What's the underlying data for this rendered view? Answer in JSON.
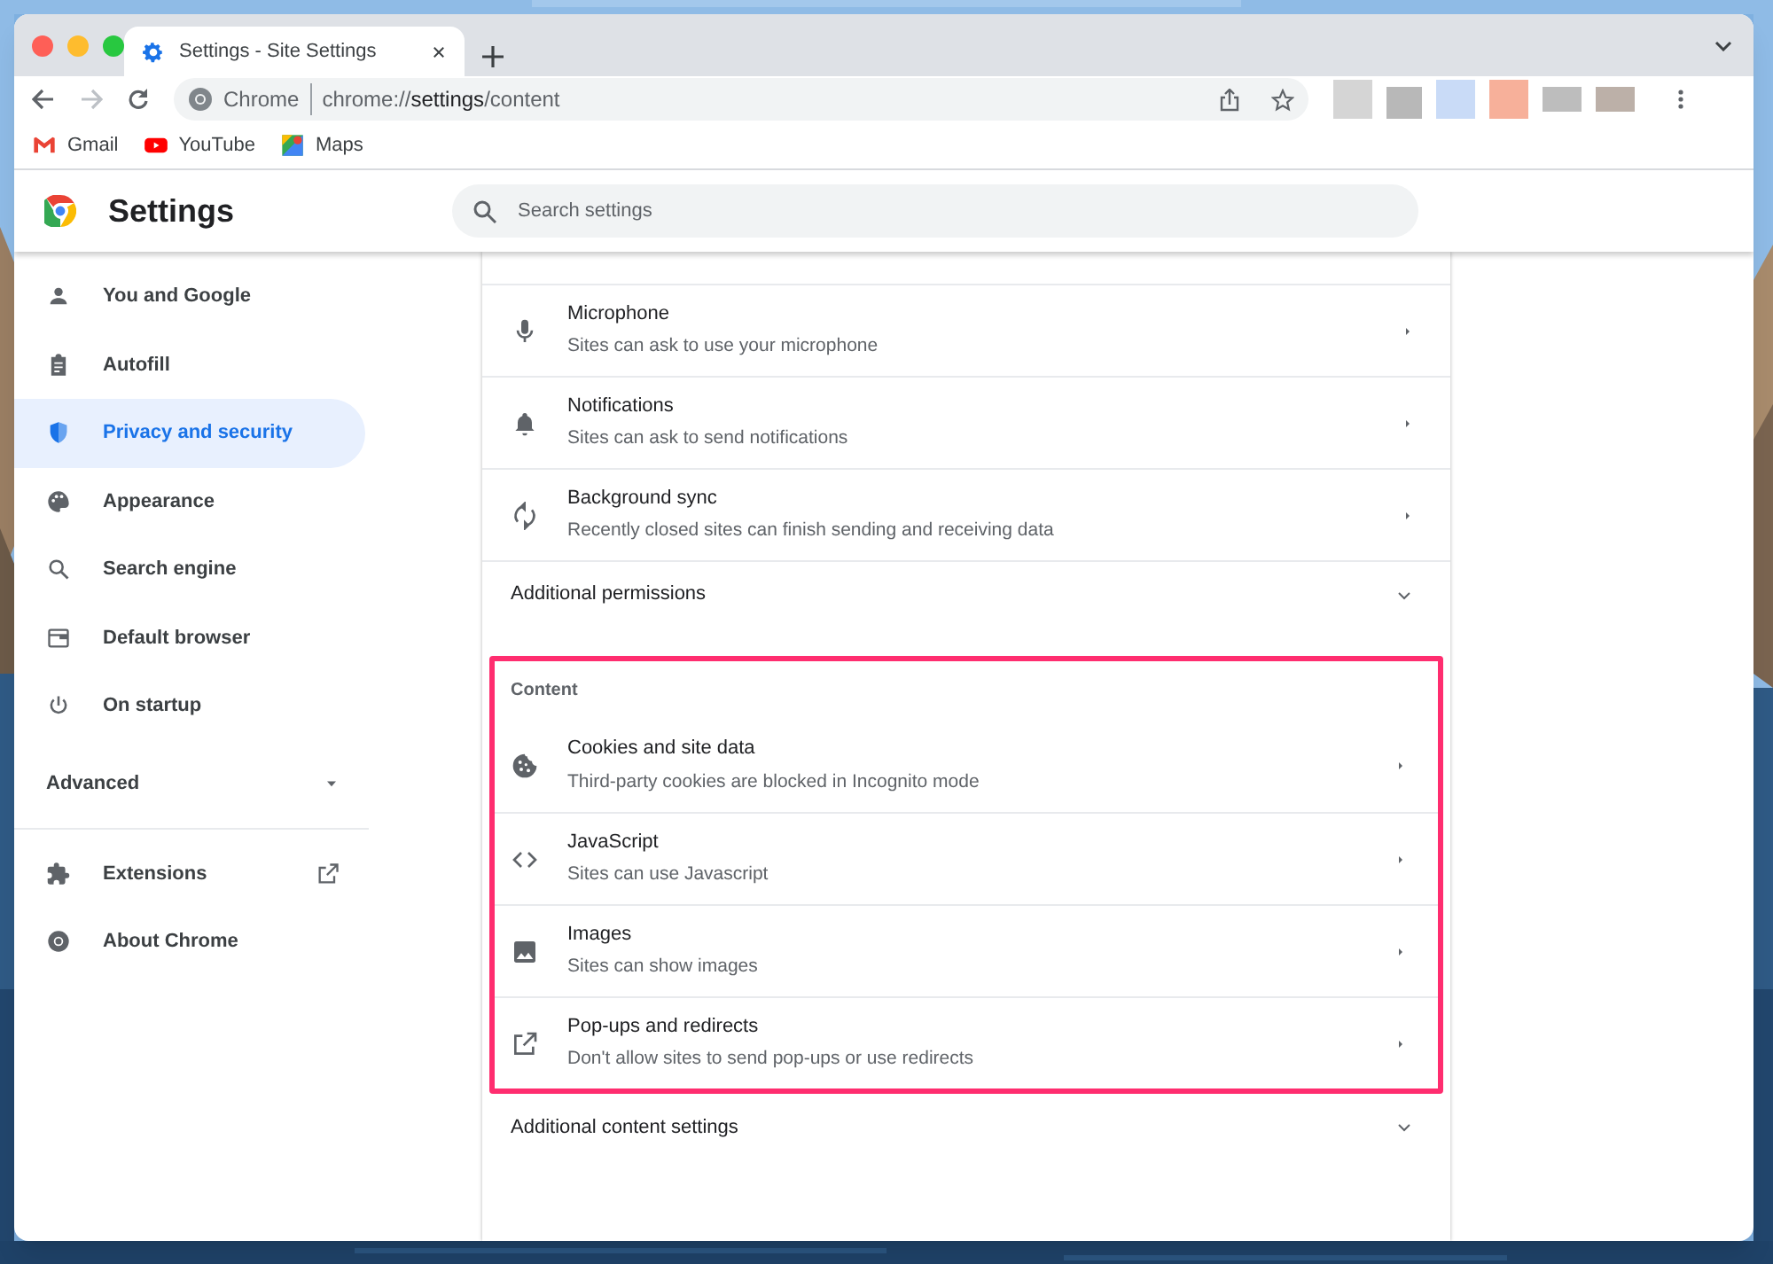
{
  "browser": {
    "tab": {
      "title": "Settings - Site Settings",
      "selected": true
    },
    "address": {
      "site_label": "Chrome",
      "url_prefix": "chrome://",
      "url_host": "settings",
      "url_path": "/content"
    },
    "bookmarks": [
      {
        "label": "Gmail"
      },
      {
        "label": "YouTube"
      },
      {
        "label": "Maps"
      }
    ]
  },
  "settings": {
    "title": "Settings",
    "search": {
      "placeholder": "Search settings"
    },
    "sidebar": {
      "items": [
        {
          "label": "You and Google",
          "selected": false
        },
        {
          "label": "Autofill",
          "selected": false
        },
        {
          "label": "Privacy and security",
          "selected": true
        },
        {
          "label": "Appearance",
          "selected": false
        },
        {
          "label": "Search engine",
          "selected": false
        },
        {
          "label": "Default browser",
          "selected": false
        },
        {
          "label": "On startup",
          "selected": false
        }
      ],
      "advanced": {
        "label": "Advanced",
        "expanded": false
      },
      "footer_items": [
        {
          "label": "Extensions",
          "external": true
        },
        {
          "label": "About Chrome",
          "external": false
        }
      ]
    },
    "permissions": {
      "rows": [
        {
          "title": "Microphone",
          "description": "Sites can ask to use your microphone"
        },
        {
          "title": "Notifications",
          "description": "Sites can ask to send notifications"
        },
        {
          "title": "Background sync",
          "description": "Recently closed sites can finish sending and receiving data"
        }
      ],
      "more": {
        "label": "Additional permissions",
        "expanded": false
      }
    },
    "content": {
      "heading": "Content",
      "highlighted": true,
      "rows": [
        {
          "title": "Cookies and site data",
          "description": "Third-party cookies are blocked in Incognito mode"
        },
        {
          "title": "JavaScript",
          "description": "Sites can use Javascript"
        },
        {
          "title": "Images",
          "description": "Sites can show images"
        },
        {
          "title": "Pop-ups and redirects",
          "description": "Don't allow sites to send pop-ups or use redirects"
        }
      ],
      "more": {
        "label": "Additional content settings",
        "expanded": false
      }
    }
  }
}
